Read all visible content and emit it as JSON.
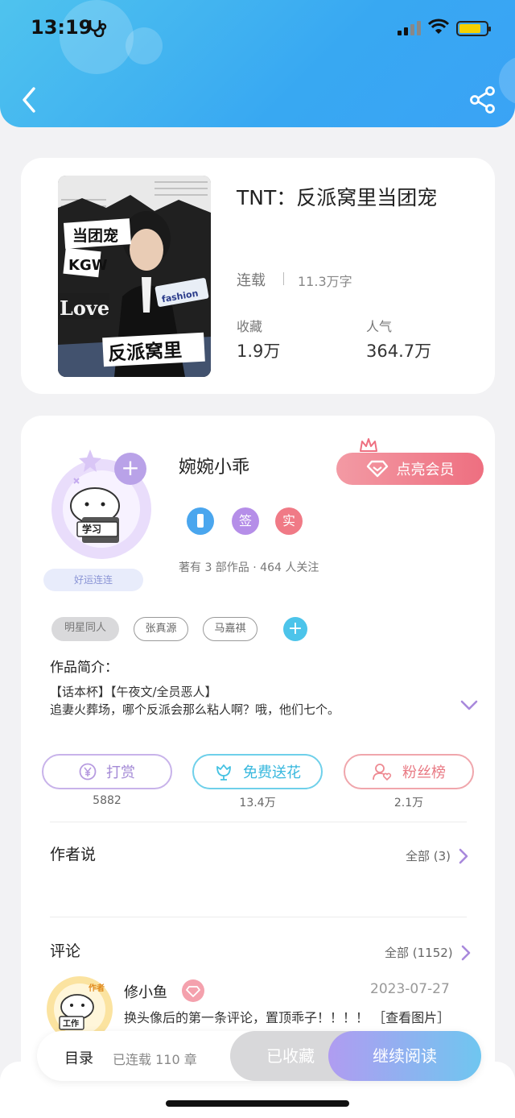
{
  "status_bar": {
    "time": "13:19",
    "health_icon": "stethoscope-icon",
    "battery_color": "#f5d100"
  },
  "header": {
    "back_icon": "chevron-left-icon",
    "share_icon": "share-icon",
    "bg_color": "#3aa8f2"
  },
  "book": {
    "title": "TNT：反派窝里当团宠",
    "status": "连载",
    "word_count": "11.3万字",
    "stats": [
      {
        "label": "收藏",
        "value": "1.9万"
      },
      {
        "label": "人气",
        "value": "364.7万"
      }
    ],
    "cover": {
      "tag_top": "当团宠",
      "tag_left": "KGW",
      "tag_word": "Love",
      "tag_bottom": "反派窝里",
      "tag_fashion": "fashion"
    }
  },
  "author": {
    "name": "婉婉小乖",
    "vip_button": "点亮会员",
    "lucky_tag": "好运连连",
    "avatar_label": "学习",
    "badges": [
      {
        "icon": "phone-icon",
        "text": "",
        "color": "#4aa6ee"
      },
      {
        "icon": "sign-badge-icon",
        "text": "签",
        "color": "#b58ee8"
      },
      {
        "icon": "verified-badge-icon",
        "text": "实",
        "color": "#f07a86"
      }
    ],
    "works_info": "著有 3 部作品 · 464 人关注"
  },
  "tags": [
    "明星同人",
    "张真源",
    "马嘉祺"
  ],
  "intro": {
    "title": "作品简介：",
    "lines": [
      "【话本杯】【午夜文/全员恶人】",
      "追妻火葬场，哪个反派会那么粘人啊？哦，他们七个。"
    ]
  },
  "actions": [
    {
      "label": "打赏",
      "count": "5882",
      "icon": "yen-icon",
      "color": "#b79be0"
    },
    {
      "label": "免费送花",
      "count": "13.4万",
      "icon": "flower-icon",
      "color": "#45c2e2"
    },
    {
      "label": "粉丝榜",
      "count": "2.1万",
      "icon": "fan-user-icon",
      "color": "#ee8a92"
    }
  ],
  "author_says": {
    "title": "作者说",
    "more": "全部 (3)"
  },
  "comments": {
    "title": "评论",
    "more": "全部 (1152)",
    "items": [
      {
        "user": "修小鱼",
        "date": "2023-07-27",
        "text": "换头像后的第一条评论，置顶乖子！！！！ ［查看图片］",
        "avatar_label": "工作",
        "avatar_tag": "作者"
      }
    ]
  },
  "bottom_bar": {
    "toc_label": "目录",
    "toc_count": "已连载 110 章",
    "collected_label": "已收藏",
    "read_label": "继续阅读"
  }
}
